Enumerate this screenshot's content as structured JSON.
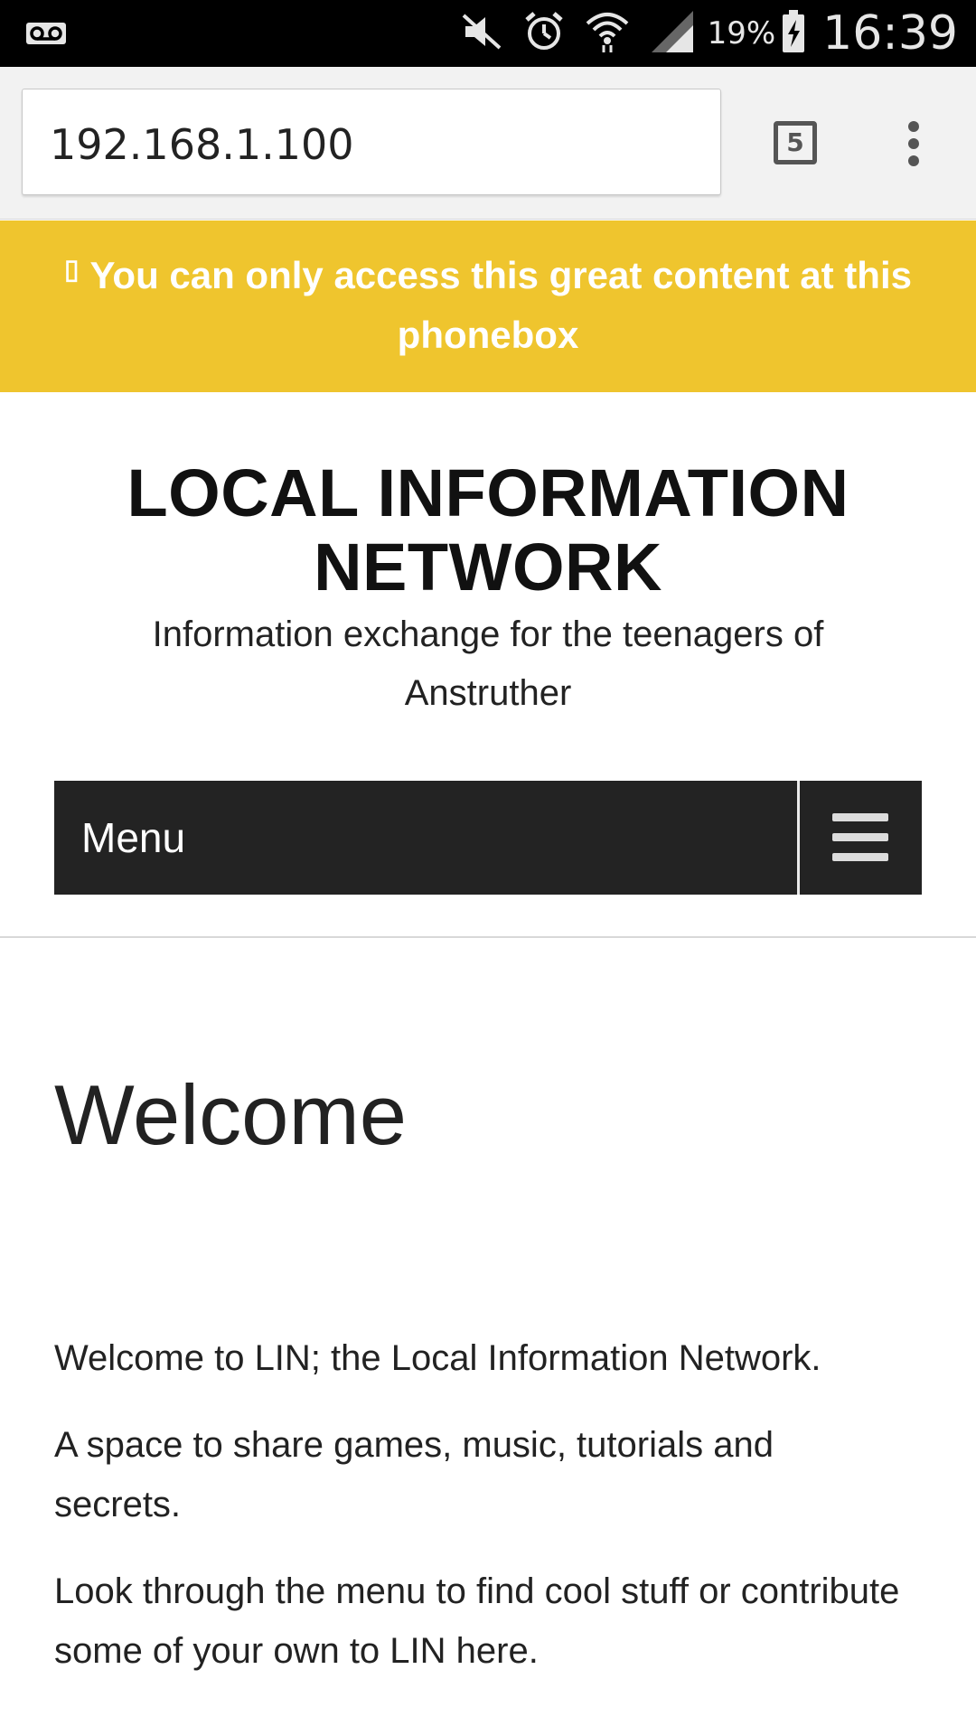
{
  "status_bar": {
    "battery_percent": "19%",
    "time": "16:39",
    "icons": [
      "voicemail-icon",
      "mute-icon",
      "alarm-icon",
      "wifi-icon",
      "signal-icon",
      "battery-charging-icon"
    ]
  },
  "browser": {
    "url": "192.168.1.100",
    "tab_count": "5",
    "menu_icon": "overflow-menu-icon"
  },
  "notice": {
    "glyph": "▯",
    "text": "You can only access this great content at this phonebox"
  },
  "site": {
    "title": "LOCAL INFORMATION NETWORK",
    "tagline": "Information exchange for the teenagers of Anstruther"
  },
  "nav": {
    "label": "Menu",
    "toggle_icon": "hamburger-icon"
  },
  "content": {
    "heading": "Welcome",
    "paragraphs": [
      "Welcome to LIN; the Local Information Network.",
      "A space to share games, music, tutorials and secrets.",
      "Look through the menu to find cool stuff or contribute some of your own to LIN here."
    ]
  },
  "colors": {
    "notice_bg": "#efc52e",
    "menu_bg": "#232323",
    "status_bg": "#000000"
  }
}
